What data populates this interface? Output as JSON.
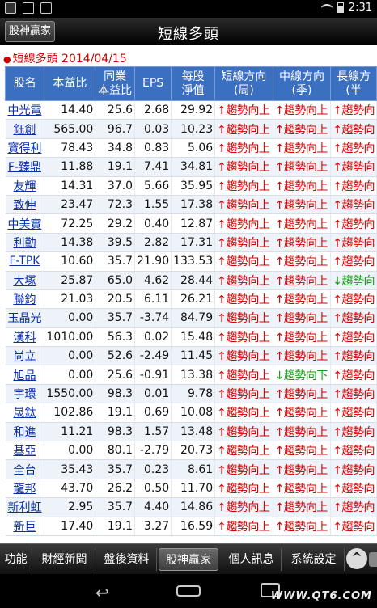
{
  "status": {
    "time": "2:31"
  },
  "header": {
    "back_label": "股神贏家",
    "title": "短線多頭"
  },
  "subheader": "短線多頭 2014/04/15",
  "table": {
    "columns": [
      {
        "line1": "股名",
        "line2": ""
      },
      {
        "line1": "本益比",
        "line2": ""
      },
      {
        "line1": "同業",
        "line2": "本益比"
      },
      {
        "line1": "EPS",
        "line2": ""
      },
      {
        "line1": "每股",
        "line2": "淨值"
      },
      {
        "line1": "短線方向",
        "line2": "(周)"
      },
      {
        "line1": "中線方向",
        "line2": "(季)"
      },
      {
        "line1": "長線方",
        "line2": "(半"
      }
    ],
    "rows": [
      {
        "name": "中光電",
        "pe": "14.40",
        "ind_pe": "25.6",
        "eps": "2.68",
        "nav": "29.92",
        "short": "↑趨勢向上",
        "mid": "↑趨勢向上",
        "mid_dir": "up",
        "long": "↑趨勢向"
      },
      {
        "name": "鈺創",
        "pe": "565.00",
        "ind_pe": "96.7",
        "eps": "0.03",
        "nav": "10.23",
        "short": "↑趨勢向上",
        "mid": "↑趨勢向上",
        "mid_dir": "up",
        "long": "↑趨勢向"
      },
      {
        "name": "寶得利",
        "pe": "78.43",
        "ind_pe": "34.8",
        "eps": "0.83",
        "nav": "5.06",
        "short": "↑趨勢向上",
        "mid": "↑趨勢向上",
        "mid_dir": "up",
        "long": "↑趨勢向"
      },
      {
        "name": "F-臻鼎",
        "pe": "11.88",
        "ind_pe": "19.1",
        "eps": "7.41",
        "nav": "34.81",
        "short": "↑趨勢向上",
        "mid": "↑趨勢向上",
        "mid_dir": "up",
        "long": "↑趨勢向"
      },
      {
        "name": "友輝",
        "pe": "14.31",
        "ind_pe": "37.0",
        "eps": "5.66",
        "nav": "35.95",
        "short": "↑趨勢向上",
        "mid": "↑趨勢向上",
        "mid_dir": "up",
        "long": "↑趨勢向"
      },
      {
        "name": "致伸",
        "pe": "23.47",
        "ind_pe": "72.3",
        "eps": "1.55",
        "nav": "17.38",
        "short": "↑趨勢向上",
        "mid": "↑趨勢向上",
        "mid_dir": "up",
        "long": "↑趨勢向"
      },
      {
        "name": "中美實",
        "pe": "72.25",
        "ind_pe": "29.2",
        "eps": "0.40",
        "nav": "12.87",
        "short": "↑趨勢向上",
        "mid": "↑趨勢向上",
        "mid_dir": "up",
        "long": "↑趨勢向"
      },
      {
        "name": "利勤",
        "pe": "14.38",
        "ind_pe": "39.5",
        "eps": "2.82",
        "nav": "17.31",
        "short": "↑趨勢向上",
        "mid": "↑趨勢向上",
        "mid_dir": "up",
        "long": "↑趨勢向"
      },
      {
        "name": "F-TPK",
        "pe": "10.60",
        "ind_pe": "35.7",
        "eps": "21.90",
        "nav": "133.53",
        "short": "↑趨勢向上",
        "mid": "↑趨勢向上",
        "mid_dir": "up",
        "long": "↑趨勢向"
      },
      {
        "name": "大塚",
        "pe": "25.87",
        "ind_pe": "65.0",
        "eps": "4.62",
        "nav": "28.44",
        "short": "↑趨勢向上",
        "mid": "↑趨勢向上",
        "mid_dir": "up",
        "long": "↓趨勢向",
        "long_dir": "down"
      },
      {
        "name": "聯鈞",
        "pe": "21.03",
        "ind_pe": "20.5",
        "eps": "6.11",
        "nav": "26.21",
        "short": "↑趨勢向上",
        "mid": "↑趨勢向上",
        "mid_dir": "up",
        "long": "↑趨勢向"
      },
      {
        "name": "玉晶光",
        "pe": "0.00",
        "ind_pe": "35.7",
        "eps": "-3.74",
        "nav": "84.79",
        "short": "↑趨勢向上",
        "mid": "↑趨勢向上",
        "mid_dir": "up",
        "long": "↑趨勢向"
      },
      {
        "name": "漢科",
        "pe": "1010.00",
        "ind_pe": "56.3",
        "eps": "0.02",
        "nav": "15.48",
        "short": "↑趨勢向上",
        "mid": "↑趨勢向上",
        "mid_dir": "up",
        "long": "↑趨勢向"
      },
      {
        "name": "尚立",
        "pe": "0.00",
        "ind_pe": "52.6",
        "eps": "-2.49",
        "nav": "11.45",
        "short": "↑趨勢向上",
        "mid": "↑趨勢向上",
        "mid_dir": "up",
        "long": "↑趨勢向"
      },
      {
        "name": "旭品",
        "pe": "0.00",
        "ind_pe": "25.6",
        "eps": "-0.91",
        "nav": "13.38",
        "short": "↑趨勢向上",
        "mid": "↓趨勢向下",
        "mid_dir": "down",
        "long": "↑趨勢向"
      },
      {
        "name": "宇環",
        "pe": "1550.00",
        "ind_pe": "98.3",
        "eps": "0.01",
        "nav": "9.78",
        "short": "↑趨勢向上",
        "mid": "↑趨勢向上",
        "mid_dir": "up",
        "long": "↑趨勢向"
      },
      {
        "name": "晟鈦",
        "pe": "102.86",
        "ind_pe": "19.1",
        "eps": "0.69",
        "nav": "10.08",
        "short": "↑趨勢向上",
        "mid": "↑趨勢向上",
        "mid_dir": "up",
        "long": "↑趨勢向"
      },
      {
        "name": "和進",
        "pe": "11.21",
        "ind_pe": "98.3",
        "eps": "1.57",
        "nav": "13.48",
        "short": "↑趨勢向上",
        "mid": "↑趨勢向上",
        "mid_dir": "up",
        "long": "↑趨勢向"
      },
      {
        "name": "基亞",
        "pe": "0.00",
        "ind_pe": "80.1",
        "eps": "-2.79",
        "nav": "20.73",
        "short": "↑趨勢向上",
        "mid": "↑趨勢向上",
        "mid_dir": "up",
        "long": "↑趨勢向"
      },
      {
        "name": "全台",
        "pe": "35.43",
        "ind_pe": "35.7",
        "eps": "0.23",
        "nav": "8.61",
        "short": "↑趨勢向上",
        "mid": "↑趨勢向上",
        "mid_dir": "up",
        "long": "↑趨勢向"
      },
      {
        "name": "龍邦",
        "pe": "43.70",
        "ind_pe": "26.2",
        "eps": "0.50",
        "nav": "11.70",
        "short": "↑趨勢向上",
        "mid": "↑趨勢向上",
        "mid_dir": "up",
        "long": "↑趨勢向"
      },
      {
        "name": "新利虹",
        "pe": "2.95",
        "ind_pe": "35.7",
        "eps": "4.40",
        "nav": "14.86",
        "short": "↑趨勢向上",
        "mid": "↑趨勢向上",
        "mid_dir": "up",
        "long": "↑趨勢向"
      },
      {
        "name": "新巨",
        "pe": "17.40",
        "ind_pe": "19.1",
        "eps": "3.27",
        "nav": "16.59",
        "short": "↑趨勢向上",
        "mid": "↑趨勢向上",
        "mid_dir": "up",
        "long": "↑趨勢向"
      }
    ]
  },
  "tabs": [
    {
      "label": "功能",
      "active": false
    },
    {
      "label": "財經新聞",
      "active": false
    },
    {
      "label": "盤後資料",
      "active": false
    },
    {
      "label": "股神贏家",
      "active": true
    },
    {
      "label": "個人訊息",
      "active": false
    },
    {
      "label": "系統設定",
      "active": false
    }
  ],
  "watermark": "WWW.QT6.COM",
  "colors": {
    "header_blue": "#3b6fc0",
    "trend_up": "#d40000",
    "trend_down": "#119a11",
    "subheader_red": "#cc0000"
  }
}
